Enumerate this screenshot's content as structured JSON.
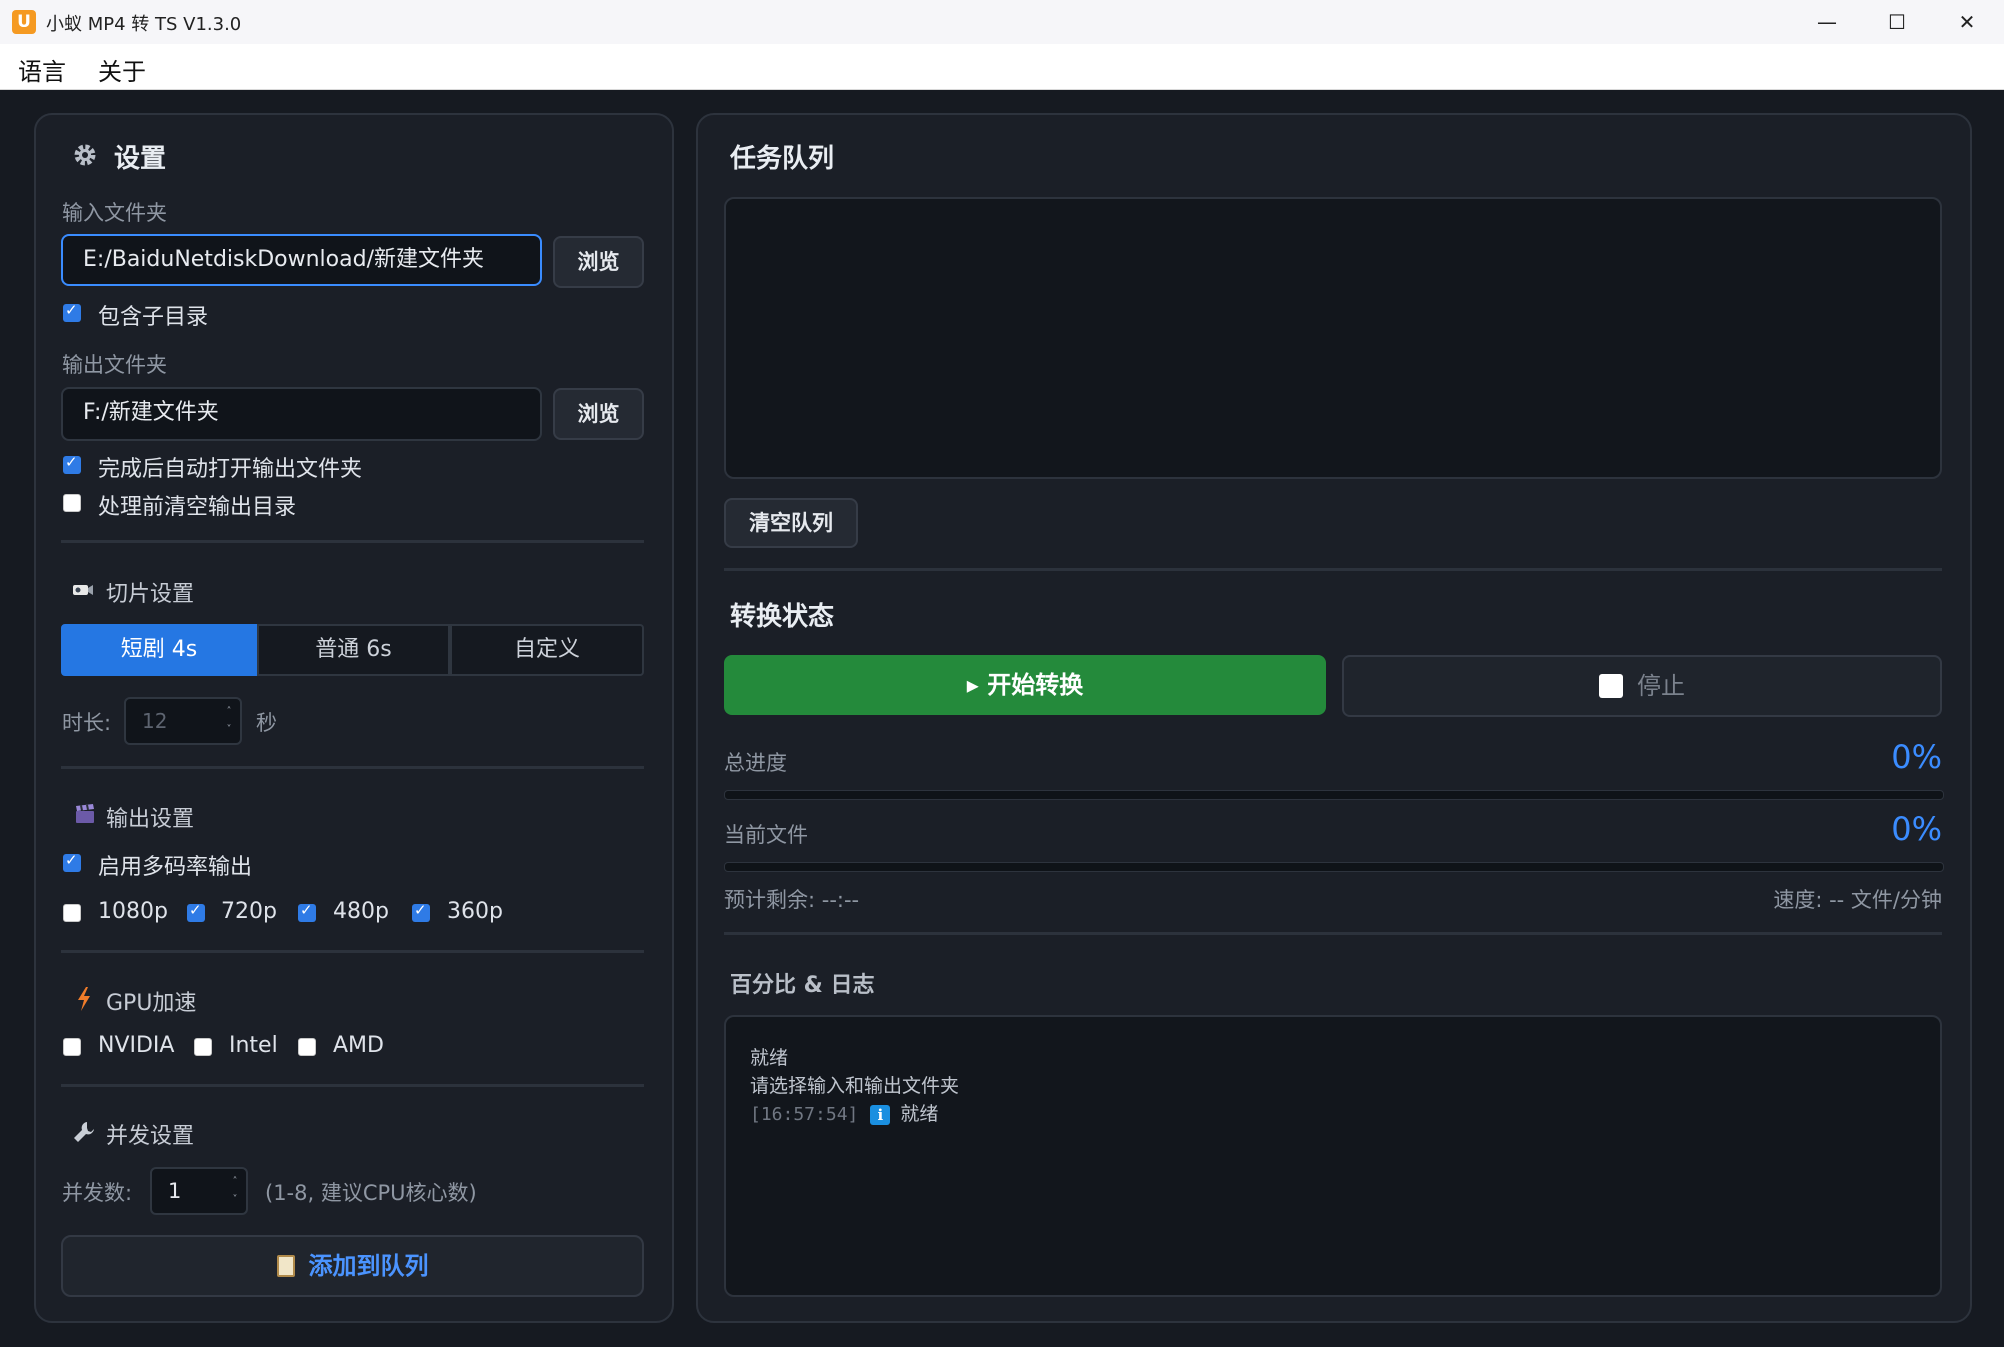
{
  "window": {
    "title": "小蚁 MP4 转 TS V1.3.0",
    "icon_letter": "U",
    "minimize": "—",
    "maximize": "☐",
    "close": "✕"
  },
  "menu": [
    "语言",
    "关于"
  ],
  "settings": {
    "title": "设置",
    "input_label": "输入文件夹",
    "input_value": "E:/BaiduNetdiskDownload/新建文件夹",
    "browse": "浏览",
    "include_subdirs": "包含子目录",
    "output_label": "输出文件夹",
    "output_value": "F:/新建文件夹",
    "auto_open": "完成后自动打开输出文件夹",
    "clear_before": "处理前清空输出目录",
    "slice_title": "切片设置",
    "slice_modes": [
      "短剧 4s",
      "普通 6s",
      "自定义"
    ],
    "duration_label": "时长:",
    "duration_value": "12",
    "duration_unit": "秒",
    "output_title": "输出设置",
    "multi_bitrate": "启用多码率输出",
    "resolutions": [
      {
        "label": "1080p",
        "checked": false
      },
      {
        "label": "720p",
        "checked": true
      },
      {
        "label": "480p",
        "checked": true
      },
      {
        "label": "360p",
        "checked": true
      }
    ],
    "gpu_title": "GPU加速",
    "gpus": [
      "NVIDIA",
      "Intel",
      "AMD"
    ],
    "concurrency_title": "并发设置",
    "concurrency_label": "并发数:",
    "concurrency_value": "1",
    "concurrency_hint": "(1-8, 建议CPU核心数)",
    "add_to_queue": "添加到队列"
  },
  "queue": {
    "title": "任务队列",
    "clear": "清空队列"
  },
  "status": {
    "title": "转换状态",
    "start": "▸ 开始转换",
    "stop": "停止",
    "total_label": "总进度",
    "total_pct": "0%",
    "total_progress": 0,
    "current_label": "当前文件",
    "current_pct": "0%",
    "current_progress": 0,
    "eta": "预计剩余: --:--",
    "speed": "速度: -- 文件/分钟"
  },
  "log": {
    "title": "百分比 & 日志",
    "lines": [
      "就绪",
      "请选择输入和输出文件夹"
    ],
    "timestamp": "[16:57:54]",
    "entry": "就绪"
  },
  "colors": {
    "accent": "#2577e3",
    "start": "#248a3b",
    "percent": "#3b8cff",
    "background": "#161a21"
  }
}
